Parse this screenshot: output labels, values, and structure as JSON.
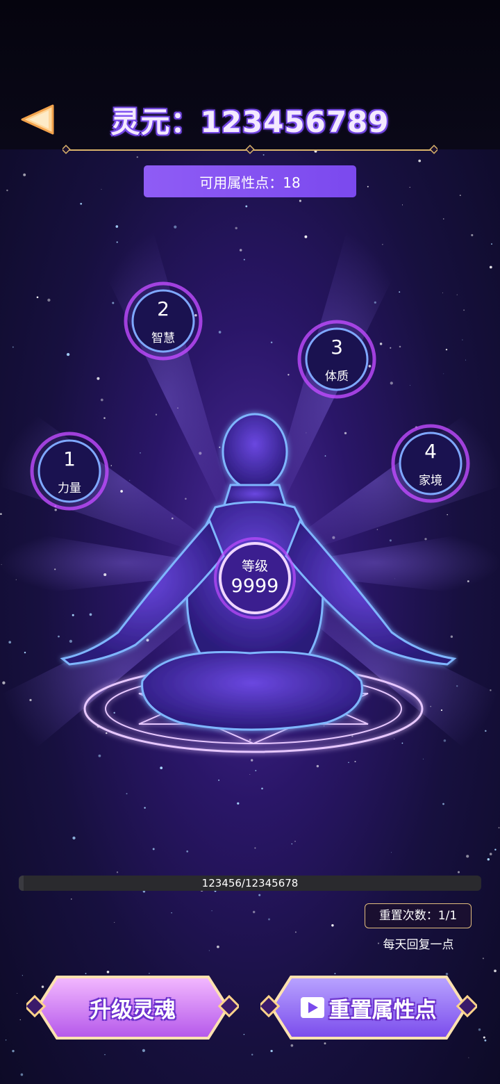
{
  "header": {
    "back_icon": "back-triangle-icon",
    "title": "灵元：123456789"
  },
  "available_points": "可用属性点：18",
  "attributes": [
    {
      "value": "1",
      "label": "力量"
    },
    {
      "value": "2",
      "label": "智慧"
    },
    {
      "value": "3",
      "label": "体质"
    },
    {
      "value": "4",
      "label": "家境"
    }
  ],
  "level": {
    "label": "等级",
    "value": "9999"
  },
  "experience": {
    "text": "123456/12345678",
    "fraction": 0.01
  },
  "reset": {
    "count_text": "重置次数：1/1",
    "tip": "每天回复一点"
  },
  "buttons": {
    "upgrade": "升级灵魂",
    "reset": "重置属性点",
    "reset_icon": "play-video-icon"
  },
  "colors": {
    "accent_purple": "#8f5cf5",
    "gold_border": "#e2bd7e",
    "orb_glow": "#c14bff"
  }
}
